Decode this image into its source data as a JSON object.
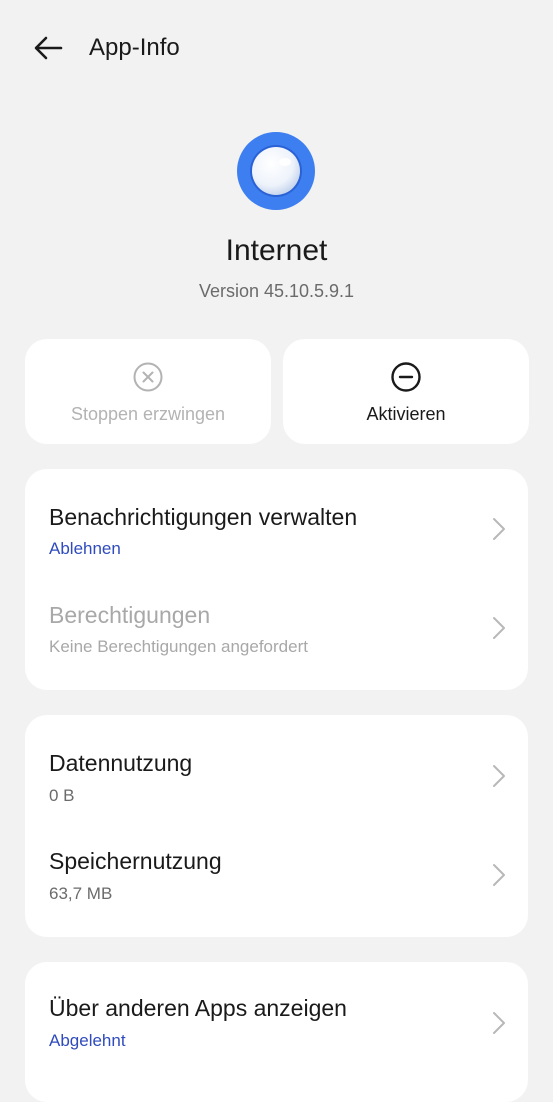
{
  "header": {
    "title": "App-Info"
  },
  "app": {
    "name": "Internet",
    "version": "Version 45.10.5.9.1"
  },
  "actions": {
    "force_stop": "Stoppen erzwingen",
    "activate": "Aktivieren"
  },
  "section1": {
    "notifications": {
      "title": "Benachrichtigungen verwalten",
      "value": "Ablehnen"
    },
    "permissions": {
      "title": "Berechtigungen",
      "value": "Keine Berechtigungen angefordert"
    }
  },
  "section2": {
    "data_usage": {
      "title": "Datennutzung",
      "value": "0 B"
    },
    "storage_usage": {
      "title": "Speichernutzung",
      "value": "63,7 MB"
    }
  },
  "section3": {
    "overlay": {
      "title": "Über anderen Apps anzeigen",
      "value": "Abgelehnt"
    }
  },
  "colors": {
    "accent": "#2f4bbd",
    "icon_blue": "#3d7ff0",
    "background": "#f2f2f2"
  },
  "icons": [
    "back-arrow-icon",
    "browser-app-icon",
    "close-circle-icon",
    "minus-circle-icon",
    "chevron-right-icon"
  ]
}
